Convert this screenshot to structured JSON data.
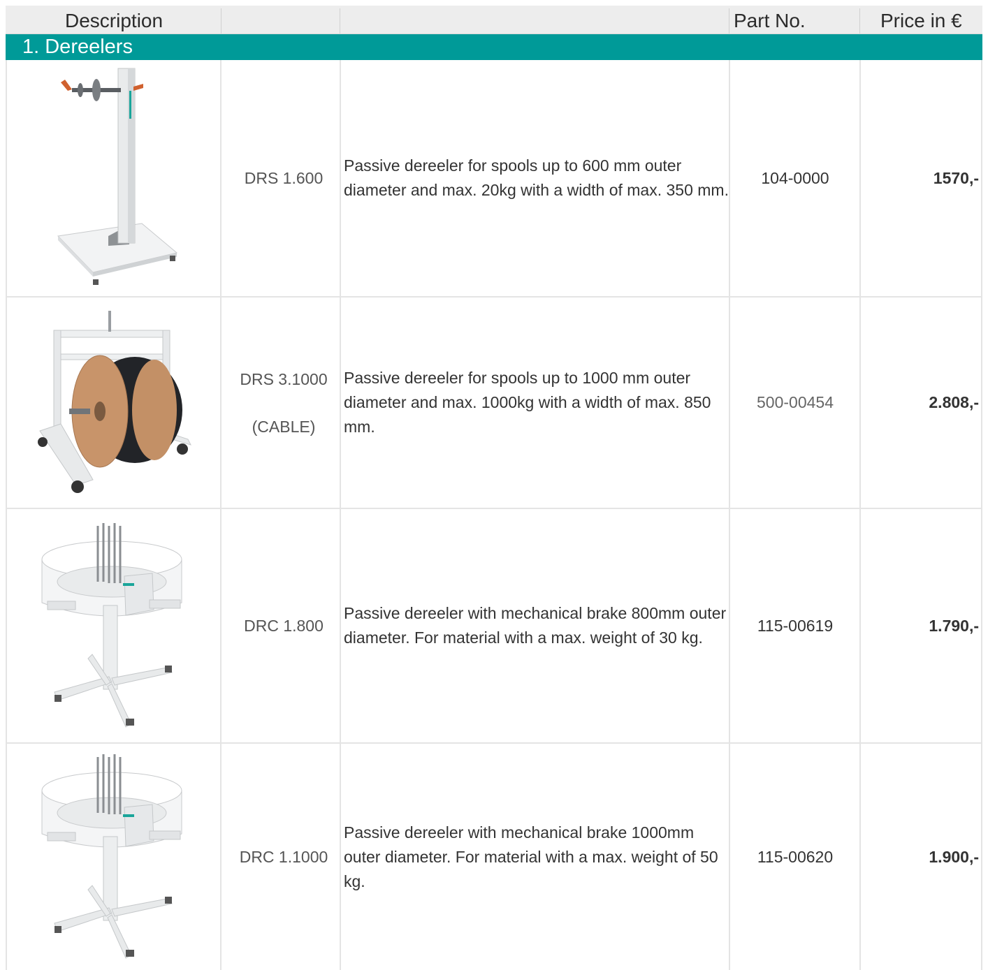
{
  "header": {
    "description": "Description",
    "part_no": "Part No.",
    "price": "Price in €"
  },
  "section": {
    "title": "1. Dereelers"
  },
  "rows": [
    {
      "image_icon": "stand-dereeler-icon",
      "model": "DRS 1.600",
      "model_sub": "",
      "description": "Passive dereeler for spools up to 600 mm  outer diameter and max. 20kg with a width of max. 350 mm.",
      "part_no": "104-0000",
      "price": "1570,-"
    },
    {
      "image_icon": "cable-spool-dereeler-icon",
      "model": "DRS 3.1000",
      "model_sub": "(CABLE)",
      "description": "Passive dereeler for spools up to 1000 mm  outer diameter and max. 1000kg with a width of max. 850 mm.",
      "part_no": "500-00454",
      "price": "2.808,-"
    },
    {
      "image_icon": "coil-basket-dereeler-icon",
      "model": "DRC 1.800",
      "model_sub": "",
      "description": "Passive dereeler with mechanical brake 800mm outer diameter. For material with a max. weight of 30 kg.",
      "part_no": "115-00619",
      "price": "1.790,-"
    },
    {
      "image_icon": "coil-basket-dereeler-icon",
      "model": "DRC 1.1000",
      "model_sub": "",
      "description": "Passive dereeler with mechanical brake 1000mm outer diameter. For material with a max. weight of 50 kg.",
      "part_no": "115-00620",
      "price": "1.900,-"
    }
  ],
  "colors": {
    "accent": "#009a98",
    "header_bg": "#ededed"
  }
}
